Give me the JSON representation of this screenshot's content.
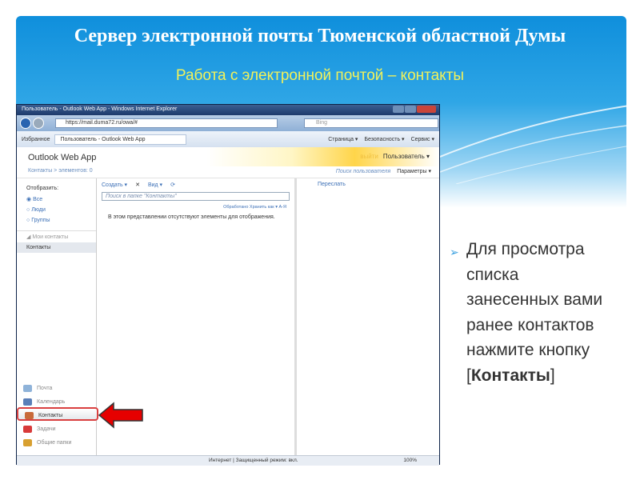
{
  "slide": {
    "title": "Сервер электронной почты Тюменской областной Думы",
    "subtitle": "Работа с электронной почтой – контакты",
    "bullet_lines": [
      "Для просмотра",
      "списка",
      "занесенных вами",
      "ранее контактов",
      "нажмите кнопку"
    ],
    "bullet_open": "[",
    "bullet_bold": "Контакты",
    "bullet_close": "]"
  },
  "browser": {
    "window_title": "Пользователь - Outlook Web App - Windows Internet Explorer",
    "url": "https://mail.duma72.ru/owa/#",
    "search_placeholder": "Bing",
    "favorites": "Избранное",
    "tab": "Пользователь - Outlook Web App",
    "commands": [
      "Страница ▾",
      "Безопасность ▾",
      "Сервис ▾"
    ],
    "status": "Интернет | Защищенный режим: вкл.",
    "zoom": "100%"
  },
  "owa": {
    "logo": "Outlook Web App",
    "logout": "выйти",
    "user": "Пользователь ▾",
    "breadcrumb": "Контакты  >  элементов: 0",
    "find_user": "Поиск пользователя",
    "options": "Параметры ▾",
    "show_label": "Отобразить:",
    "filters": [
      "Все",
      "Люди",
      "Группы"
    ],
    "my_contacts": "◢ Мои контакты",
    "contacts_folder": "Контакты",
    "toolbar": [
      "Создать ▾",
      "✕",
      "Вид ▾"
    ],
    "search_placeholder": "Поиск в папке \"Контакты\"",
    "sort": "Обработано Хранить как ▾   А-Я",
    "empty": "В этом представлении отсутствуют элементы для отображения.",
    "forward": "Переслать",
    "nav": [
      {
        "label": "Почта",
        "color": "#8fb3d9"
      },
      {
        "label": "Календарь",
        "color": "#5a7fb8"
      },
      {
        "label": "Контакты",
        "color": "#c86a3a"
      },
      {
        "label": "Задачи",
        "color": "#d83a3a"
      },
      {
        "label": "Общие папки",
        "color": "#d8a030"
      }
    ]
  },
  "colors": {
    "highlight": "#d94040",
    "arrow": "#e60000"
  }
}
